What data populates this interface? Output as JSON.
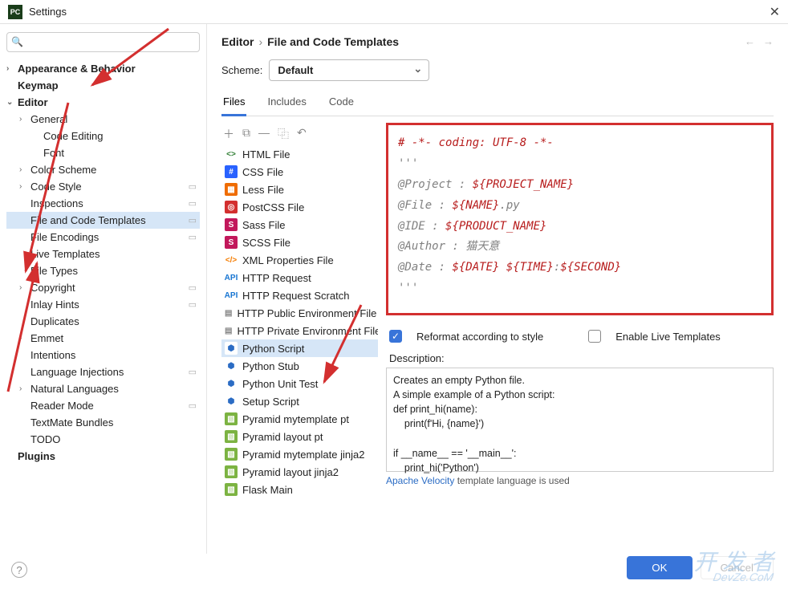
{
  "window": {
    "title": "Settings"
  },
  "search": {
    "placeholder": ""
  },
  "tree": [
    {
      "label": "Appearance & Behavior",
      "depth": 0,
      "chev": "›",
      "bold": true
    },
    {
      "label": "Keymap",
      "depth": 0,
      "bold": true
    },
    {
      "label": "Editor",
      "depth": 0,
      "chev": "⌄",
      "bold": true
    },
    {
      "label": "General",
      "depth": 1,
      "chev": "›"
    },
    {
      "label": "Code Editing",
      "depth": 2
    },
    {
      "label": "Font",
      "depth": 2
    },
    {
      "label": "Color Scheme",
      "depth": 1,
      "chev": "›"
    },
    {
      "label": "Code Style",
      "depth": 1,
      "chev": "›",
      "suffix": "▭"
    },
    {
      "label": "Inspections",
      "depth": 1,
      "suffix": "▭"
    },
    {
      "label": "File and Code Templates",
      "depth": 1,
      "selected": true,
      "suffix": "▭"
    },
    {
      "label": "File Encodings",
      "depth": 1,
      "suffix": "▭"
    },
    {
      "label": "Live Templates",
      "depth": 1
    },
    {
      "label": "File Types",
      "depth": 1
    },
    {
      "label": "Copyright",
      "depth": 1,
      "chev": "›",
      "suffix": "▭"
    },
    {
      "label": "Inlay Hints",
      "depth": 1,
      "suffix": "▭"
    },
    {
      "label": "Duplicates",
      "depth": 1
    },
    {
      "label": "Emmet",
      "depth": 1,
      "chev": "›"
    },
    {
      "label": "Intentions",
      "depth": 1
    },
    {
      "label": "Language Injections",
      "depth": 1,
      "suffix": "▭"
    },
    {
      "label": "Natural Languages",
      "depth": 1,
      "chev": "›"
    },
    {
      "label": "Reader Mode",
      "depth": 1,
      "suffix": "▭"
    },
    {
      "label": "TextMate Bundles",
      "depth": 1
    },
    {
      "label": "TODO",
      "depth": 1
    },
    {
      "label": "Plugins",
      "depth": 0,
      "bold": true
    }
  ],
  "breadcrumb": {
    "a": "Editor",
    "b": "File and Code Templates"
  },
  "scheme": {
    "label": "Scheme:",
    "value": "Default"
  },
  "tabs": [
    {
      "label": "Files",
      "active": true
    },
    {
      "label": "Includes"
    },
    {
      "label": "Code"
    }
  ],
  "files": [
    {
      "label": "HTML File",
      "icon": "<>",
      "bg": "#fff",
      "fg": "#2e7d32"
    },
    {
      "label": "CSS File",
      "icon": "#",
      "bg": "#2962ff",
      "fg": "#fff"
    },
    {
      "label": "Less File",
      "icon": "▦",
      "bg": "#ef6c00",
      "fg": "#fff"
    },
    {
      "label": "PostCSS File",
      "icon": "◎",
      "bg": "#d32f2f",
      "fg": "#fff"
    },
    {
      "label": "Sass File",
      "icon": "S",
      "bg": "#c2185b",
      "fg": "#fff"
    },
    {
      "label": "SCSS File",
      "icon": "S",
      "bg": "#c2185b",
      "fg": "#fff"
    },
    {
      "label": "XML Properties File",
      "icon": "</>",
      "bg": "#fff",
      "fg": "#f57c00"
    },
    {
      "label": "HTTP Request",
      "icon": "API",
      "bg": "#fff",
      "fg": "#1976d2"
    },
    {
      "label": "HTTP Request Scratch",
      "icon": "API",
      "bg": "#fff",
      "fg": "#1976d2"
    },
    {
      "label": "HTTP Public Environment File",
      "icon": "▤",
      "bg": "#fff",
      "fg": "#888"
    },
    {
      "label": "HTTP Private Environment File",
      "icon": "▤",
      "bg": "#fff",
      "fg": "#888"
    },
    {
      "label": "Python Script",
      "icon": "⬢",
      "bg": "#fff",
      "fg": "#2b6cc4",
      "selected": true
    },
    {
      "label": "Python Stub",
      "icon": "⬢",
      "bg": "#fff",
      "fg": "#2b6cc4"
    },
    {
      "label": "Python Unit Test",
      "icon": "⬢",
      "bg": "#fff",
      "fg": "#2b6cc4"
    },
    {
      "label": "Setup Script",
      "icon": "⬢",
      "bg": "#fff",
      "fg": "#2b6cc4"
    },
    {
      "label": "Pyramid mytemplate pt",
      "icon": "▧",
      "bg": "#7cb342",
      "fg": "#fff"
    },
    {
      "label": "Pyramid layout pt",
      "icon": "▧",
      "bg": "#7cb342",
      "fg": "#fff"
    },
    {
      "label": "Pyramid mytemplate jinja2",
      "icon": "▧",
      "bg": "#7cb342",
      "fg": "#fff"
    },
    {
      "label": "Pyramid layout jinja2",
      "icon": "▧",
      "bg": "#7cb342",
      "fg": "#fff"
    },
    {
      "label": "Flask Main",
      "icon": "▧",
      "bg": "#7cb342",
      "fg": "#fff"
    }
  ],
  "template": {
    "l1": "# -*- coding: UTF-8 -*-",
    "l2": "'''",
    "l3a": "@Project : ",
    "l3b": "${PROJECT_NAME}",
    "l4a": "@File    : ",
    "l4b": "${NAME}",
    "l4c": ".py",
    "l5a": "@IDE     : ",
    "l5b": "${PRODUCT_NAME}",
    "l6a": "@Author  : ",
    "l6b": "猫天意",
    "l7a": "@Date    : ",
    "l7b": "${DATE} ${TIME}",
    "l7c": ":",
    "l7d": "${SECOND}",
    "l8": "'''"
  },
  "opts": {
    "reformat": "Reformat according to style",
    "livetpl": "Enable Live Templates"
  },
  "desc": {
    "label": "Description:",
    "l1": "Creates an empty Python file.",
    "l2": "A simple example of a Python script:",
    "l3": "def print_hi(name):",
    "l4": "    print(f'Hi, {name}')",
    "l5": "",
    "l6": "if __name__ == '__main__':",
    "l7": "    print_hi('Python')"
  },
  "langnote": {
    "a": "Apache Velocity",
    "b": " template language is used"
  },
  "buttons": {
    "ok": "OK",
    "cancel": "Cancel"
  },
  "watermark": {
    "a": "开 发 者",
    "b": "DevZe.CoM"
  }
}
